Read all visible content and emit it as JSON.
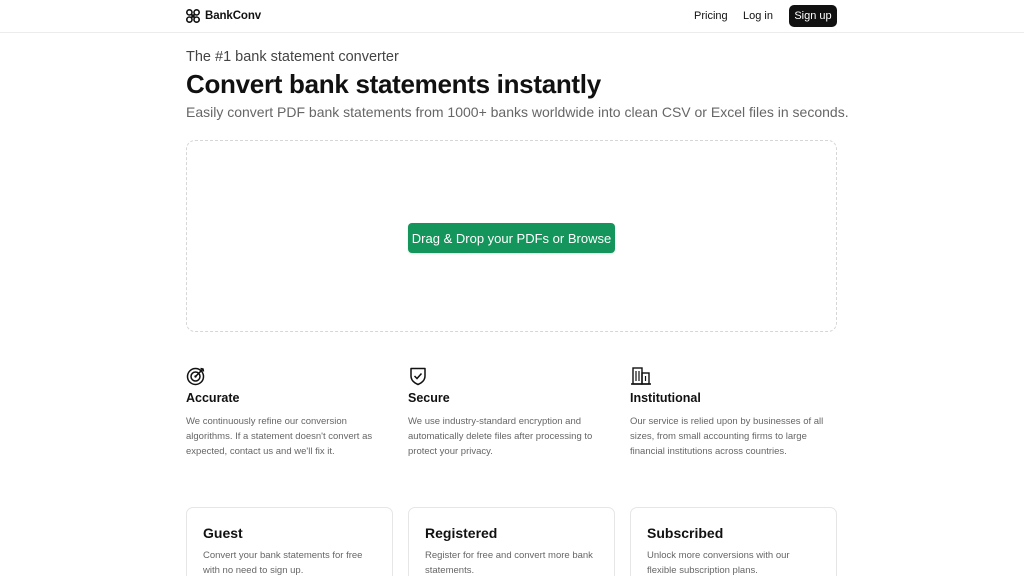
{
  "nav": {
    "brand": "BankConv",
    "logo_icon": "clover-logo-icon",
    "links": [
      "Pricing",
      "Log in"
    ],
    "signup": "Sign up"
  },
  "hero": {
    "eyebrow": "The #1 bank statement converter",
    "headline": "Convert bank statements instantly",
    "subheadline": "Easily convert PDF bank statements from 1000+ banks worldwide into clean CSV or Excel files in seconds."
  },
  "upload": {
    "button_label": "Drag & Drop your PDFs or Browse",
    "button_color": "#14955b"
  },
  "features": [
    {
      "icon": "target-icon",
      "title": "Accurate",
      "text": "We continuously refine our conversion algorithms. If a statement doesn't convert as expected, contact us and we'll fix it."
    },
    {
      "icon": "shield-check-icon",
      "title": "Secure",
      "text": "We use industry-standard encryption and automatically delete files after processing to protect your privacy."
    },
    {
      "icon": "building-icon",
      "title": "Institutional",
      "text": "Our service is relied upon by businesses of all sizes, from small accounting firms to large financial institutions across countries."
    }
  ],
  "plans": [
    {
      "title": "Guest",
      "text": "Convert your bank statements for free with no need to sign up."
    },
    {
      "title": "Registered",
      "text": "Register for free and convert more bank statements."
    },
    {
      "title": "Subscribed",
      "text": "Unlock more conversions with our flexible subscription plans."
    }
  ]
}
